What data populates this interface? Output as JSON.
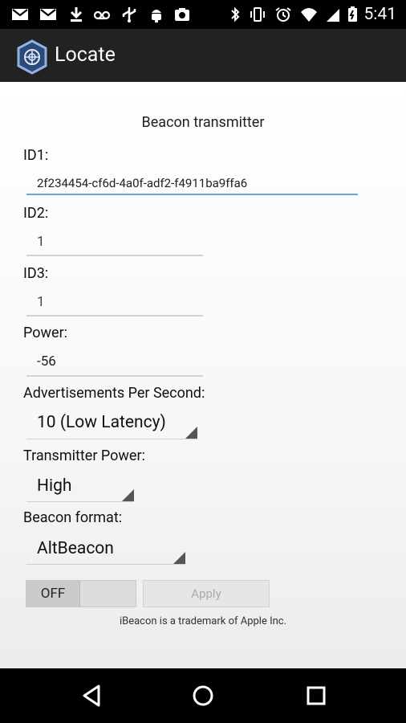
{
  "status_bar": {
    "time": "5:41",
    "left_icons": [
      "gmail-icon",
      "gmail-icon",
      "download-icon",
      "voicemail-icon",
      "usb-icon",
      "android-debug-icon",
      "photo-icon"
    ],
    "right_icons": [
      "bluetooth-icon",
      "vibrate-icon",
      "alarm-icon",
      "wifi-icon",
      "battery-icon"
    ]
  },
  "app_bar": {
    "title": "Locate"
  },
  "form": {
    "header": "Beacon transmitter",
    "id1": {
      "label": "ID1:",
      "value": "2f234454-cf6d-4a0f-adf2-f4911ba9ffa6"
    },
    "id2": {
      "label": "ID2:",
      "value": "1"
    },
    "id3": {
      "label": "ID3:",
      "value": "1"
    },
    "power": {
      "label": "Power:",
      "value": "-56"
    },
    "ads_per_second": {
      "label": "Advertisements Per Second:",
      "selected": "10 (Low Latency)"
    },
    "transmitter_power": {
      "label": "Transmitter Power:",
      "selected": "High"
    },
    "beacon_format": {
      "label": "Beacon format:",
      "selected": "AltBeacon"
    }
  },
  "controls": {
    "toggle_label": "OFF",
    "apply_label": "Apply"
  },
  "footer": {
    "trademark": "iBeacon is a trademark of Apple Inc."
  },
  "colors": {
    "accent": "#66a9d8",
    "action_bar": "#222222",
    "status_bar": "#000000"
  }
}
